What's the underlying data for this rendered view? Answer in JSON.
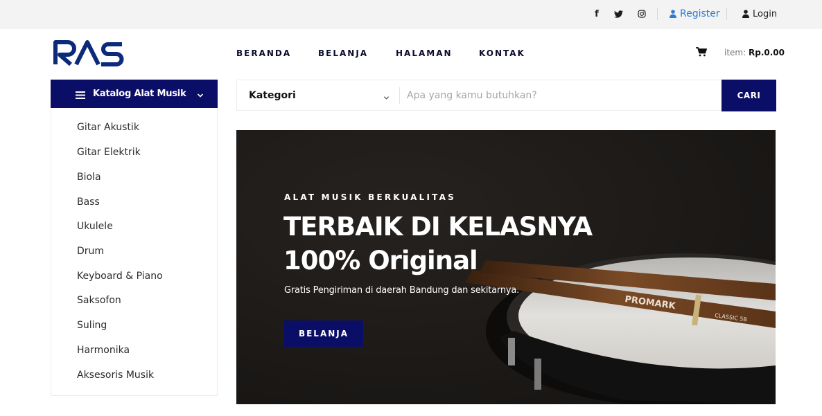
{
  "topbar": {
    "social": [
      "facebook-icon",
      "twitter-icon",
      "instagram-icon"
    ],
    "register_label": "Register",
    "login_label": "Login"
  },
  "header": {
    "logo_text": "RAS",
    "nav": [
      "BERANDA",
      "BELANJA",
      "HALAMAN",
      "KONTAK"
    ],
    "cart_label": "item:",
    "cart_total": "Rp.0.00"
  },
  "catalog": {
    "title": "Katalog Alat Musik",
    "items": [
      "Gitar Akustik",
      "Gitar Elektrik",
      "Biola",
      "Bass",
      "Ukulele",
      "Drum",
      "Keyboard & Piano",
      "Saksofon",
      "Suling",
      "Harmonika",
      "Aksesoris Musik"
    ]
  },
  "search": {
    "category_label": "Kategori",
    "placeholder": "Apa yang kamu butuhkan?",
    "button_label": "CARI"
  },
  "hero": {
    "kicker": "ALAT MUSIK BERKUALITAS",
    "title_line1": "TERBAIK DI KELASNYA",
    "title_line2": "100% Original",
    "subtitle": "Gratis Pengiriman di daerah Bandung dan sekitarnya.",
    "button_label": "BELANJA",
    "stick_text_1": "PROMARK",
    "stick_text_2": "CLASSIC 5B"
  },
  "colors": {
    "primary": "#0b0e66",
    "register_link": "#2e7bd6",
    "topbar_bg": "#f3f3f3"
  }
}
